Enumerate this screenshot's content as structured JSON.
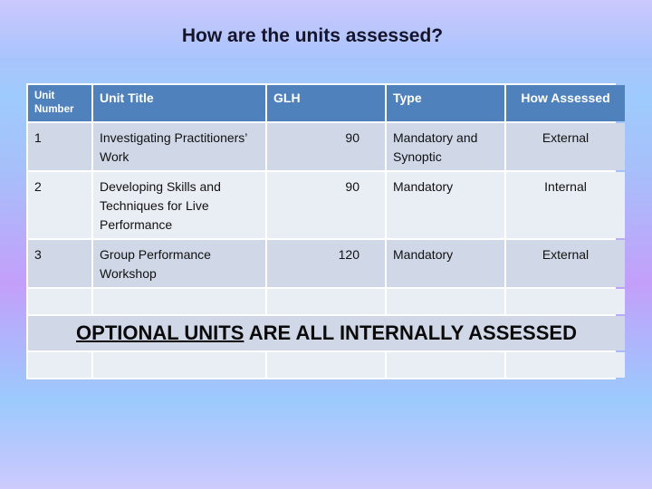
{
  "slide": {
    "title": "How are the units assessed?"
  },
  "table": {
    "headers": {
      "unit_number": "Unit Number",
      "unit_title": "Unit Title",
      "glh": "GLH",
      "type": "Type",
      "how_assessed": "How Assessed"
    },
    "rows": [
      {
        "unit_number": "1",
        "unit_title": "Investigating Practitioners’ Work",
        "glh": "90",
        "type": "Mandatory and Synoptic",
        "how_assessed": "External"
      },
      {
        "unit_number": "2",
        "unit_title": "Developing Skills and Techniques for Live Performance",
        "glh": "90",
        "type": "Mandatory",
        "how_assessed": "Internal"
      },
      {
        "unit_number": "3",
        "unit_title": "Group Performance Workshop",
        "glh": "120",
        "type": "Mandatory",
        "how_assessed": "External"
      }
    ],
    "banner": {
      "underlined": "OPTIONAL UNITS",
      "rest": " ARE ALL INTERNALLY ASSESSED"
    }
  },
  "colors": {
    "header_bg": "#4f81bd",
    "row_odd_bg": "#d0d8e8",
    "row_even_bg": "#e9edf4"
  }
}
